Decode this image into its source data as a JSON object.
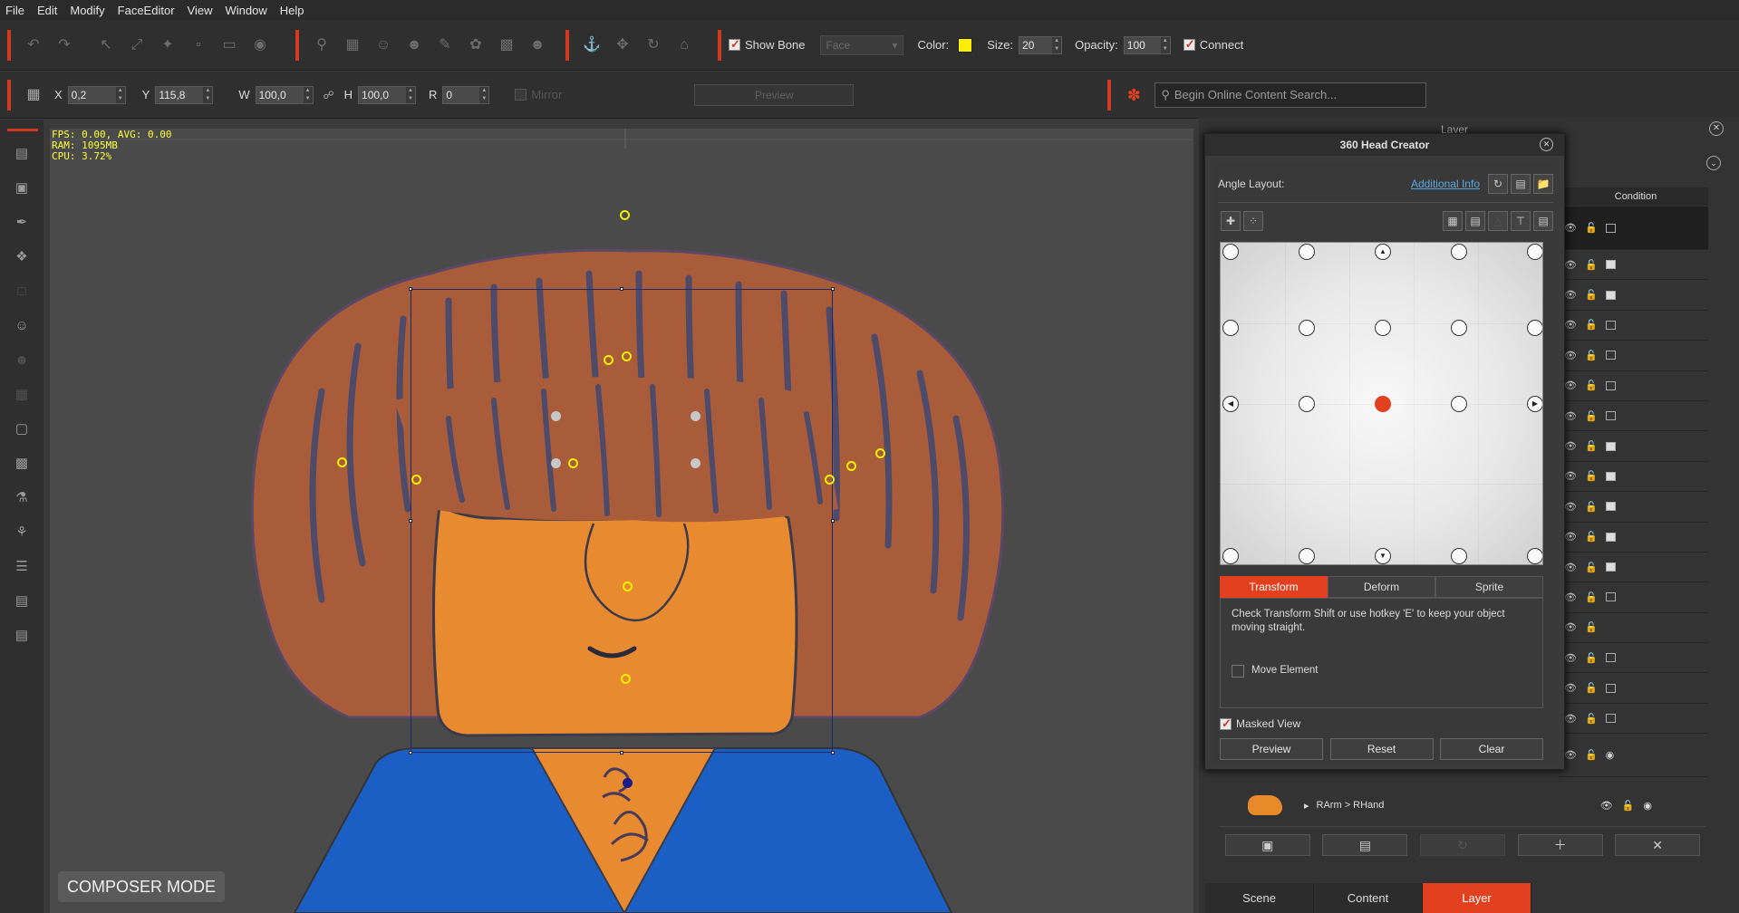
{
  "menu": [
    "File",
    "Edit",
    "Modify",
    "FaceEditor",
    "View",
    "Window",
    "Help"
  ],
  "toolbar1": {
    "show_bone_label": "Show Bone",
    "show_bone_checked": true,
    "face_select": "Face",
    "color_label": "Color:",
    "color_value": "#ffee00",
    "size_label": "Size:",
    "size_value": "20",
    "opacity_label": "Opacity:",
    "opacity_value": "100",
    "connect_label": "Connect",
    "connect_checked": true
  },
  "toolbar2": {
    "x_label": "X",
    "x_value": "0,2",
    "y_label": "Y",
    "y_value": "115,8",
    "w_label": "W",
    "w_value": "100,0",
    "h_label": "H",
    "h_value": "100,0",
    "r_label": "R",
    "r_value": "0",
    "mirror_label": "Mirror",
    "preview_label": "Preview",
    "search_placeholder": "Begin Online Content Search..."
  },
  "stats": {
    "fps": "FPS: 0.00, AVG: 0.00",
    "ram": "RAM: 1095MB",
    "cpu": "CPU: 3.72%"
  },
  "composer_mode": "COMPOSER MODE",
  "layer_panel": {
    "title": "Layer",
    "condition_header": "Condition",
    "rarm_label": "RArm > RHand",
    "tabs": [
      "Scene",
      "Content",
      "Layer"
    ],
    "active_tab": "Layer"
  },
  "head_creator": {
    "title": "360 Head Creator",
    "angle_layout_label": "Angle Layout:",
    "additional_info": "Additional Info",
    "tabs": [
      "Transform",
      "Deform",
      "Sprite"
    ],
    "active_tab": "Transform",
    "hint": "Check Transform Shift or use hotkey 'E' to keep your object moving straight.",
    "move_element_label": "Move Element",
    "move_element_checked": false,
    "masked_view_label": "Masked View",
    "masked_view_checked": true,
    "buttons": [
      "Preview",
      "Reset",
      "Clear"
    ]
  },
  "colors": {
    "accent": "#e2401f",
    "hair": "#a85c3a",
    "face": "#e88a30",
    "shirt": "#1c5fc4",
    "bone_points": "#f6f000"
  }
}
